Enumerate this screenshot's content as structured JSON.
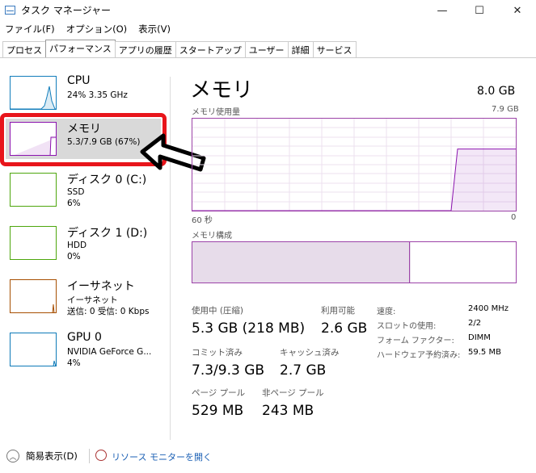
{
  "window": {
    "title": "タスク マネージャー",
    "min_glyph": "—",
    "max_glyph": "☐",
    "close_glyph": "✕"
  },
  "menu": [
    "ファイル(F)",
    "オプション(O)",
    "表示(V)"
  ],
  "tabs": [
    "プロセス",
    "パフォーマンス",
    "アプリの履歴",
    "スタートアップ",
    "ユーザー",
    "詳細",
    "サービス"
  ],
  "active_tab": "パフォーマンス",
  "sidebar": {
    "items": [
      {
        "title": "CPU",
        "line1": "24%  3.35 GHz",
        "line2": "",
        "line3": ""
      },
      {
        "title": "メモリ",
        "line1": "5.3/7.9 GB (67%)",
        "line2": "",
        "line3": ""
      },
      {
        "title": "ディスク 0 (C:)",
        "line1": "SSD",
        "line2": "6%",
        "line3": ""
      },
      {
        "title": "ディスク 1 (D:)",
        "line1": "HDD",
        "line2": "0%",
        "line3": ""
      },
      {
        "title": "イーサネット",
        "line1": "イーサネット",
        "line2": "送信: 0 受信: 0 Kbps",
        "line3": ""
      },
      {
        "title": "GPU 0",
        "line1": "NVIDIA GeForce G...",
        "line2": "4%",
        "line3": ""
      }
    ],
    "cpu_color": "#117dbb",
    "memory_color": "#8b12ae",
    "disk_color": "#4da60c",
    "ethernet_color": "#a74f01",
    "gpu_color": "#0d7ab8"
  },
  "memory": {
    "title": "メモリ",
    "total": "8.0 GB",
    "usage_label": "メモリ使用量",
    "usage_max": "7.9 GB",
    "axis_left": "60 秒",
    "axis_right": "0",
    "composition_label": "メモリ構成",
    "usage_level": 0.67,
    "stats": {
      "in_use_label": "使用中 (圧縮)",
      "in_use_value": "5.3 GB (218 MB)",
      "available_label": "利用可能",
      "available_value": "2.6 GB",
      "committed_label": "コミット済み",
      "committed_value": "7.3/9.3 GB",
      "cached_label": "キャッシュ済み",
      "cached_value": "2.7 GB",
      "paged_label": "ページ プール",
      "paged_value": "529 MB",
      "nonpaged_label": "非ページ プール",
      "nonpaged_value": "243 MB"
    },
    "details": [
      {
        "label": "速度:",
        "value": "2400 MHz"
      },
      {
        "label": "スロットの使用:",
        "value": "2/2"
      },
      {
        "label": "フォーム ファクター:",
        "value": "DIMM"
      },
      {
        "label": "ハードウェア予約済み:",
        "value": "59.5 MB"
      }
    ]
  },
  "footer": {
    "simple_view": "簡易表示(D)",
    "resource_monitor": "リソース モニターを開く"
  },
  "annotation": {
    "arrow_color": "#000000",
    "highlight_color": "#e8151b"
  }
}
